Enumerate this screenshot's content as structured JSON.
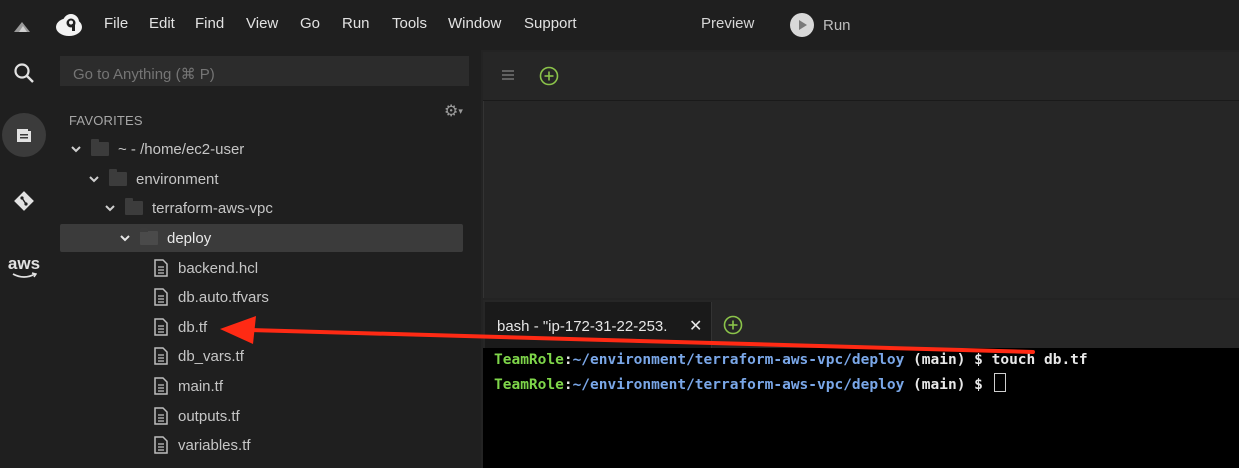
{
  "menubar": {
    "items": [
      "File",
      "Edit",
      "Find",
      "View",
      "Go",
      "Run",
      "Tools",
      "Window",
      "Support"
    ],
    "preview": "Preview",
    "run": "Run"
  },
  "rail": {
    "icons": [
      "search-icon",
      "files-icon",
      "git-icon",
      "aws-icon"
    ],
    "aws_label": "aws"
  },
  "tree": {
    "goto_placeholder": "Go to Anything (⌘ P)",
    "favorites": "FAVORITES",
    "root": "~ - /home/ec2-user",
    "folders": [
      "environment",
      "terraform-aws-vpc",
      "deploy"
    ],
    "files": [
      "backend.hcl",
      "db.auto.tfvars",
      "db.tf",
      "db_vars.tf",
      "main.tf",
      "outputs.tf",
      "variables.tf"
    ],
    "selected": "deploy"
  },
  "terminal": {
    "tab_label": "bash - \"ip-172-31-22-253.",
    "lines": [
      {
        "role": "TeamRole",
        "sep": ":",
        "path": "~/environment/terraform-aws-vpc/deploy",
        "rest": " (main) $ touch db.tf"
      },
      {
        "role": "TeamRole",
        "sep": ":",
        "path": "~/environment/terraform-aws-vpc/deploy",
        "rest": " (main) $ "
      }
    ]
  },
  "colors": {
    "accent_green": "#8bc34a",
    "arrow_red": "#ff2a14",
    "prompt_green": "#7fd64a",
    "path_blue": "#7aa7e8"
  }
}
